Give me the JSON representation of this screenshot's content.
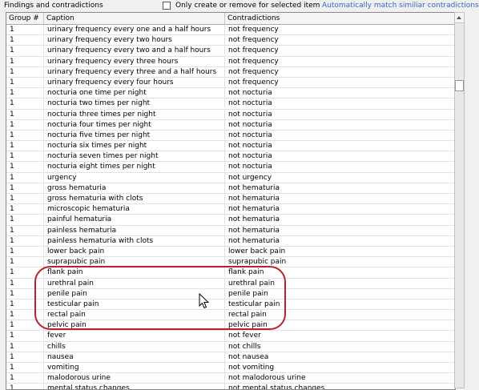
{
  "section_title": "Findings and contradictions",
  "checkbox": {
    "label": "Only create or remove for selected item",
    "checked": false
  },
  "match_link": "Automatically match similiar contradictions",
  "table": {
    "headers": {
      "group": "Group #",
      "caption": "Caption",
      "contradictions": "Contradictions"
    },
    "rows": [
      {
        "group": "1",
        "caption": "urinary frequency every one and a half hours",
        "contra": "not frequency"
      },
      {
        "group": "1",
        "caption": "urinary frequency every two hours",
        "contra": "not frequency"
      },
      {
        "group": "1",
        "caption": "urinary frequency every two and a half hours",
        "contra": "not frequency"
      },
      {
        "group": "1",
        "caption": "urinary frequency every three hours",
        "contra": "not frequency"
      },
      {
        "group": "1",
        "caption": "urinary frequency every three and a half hours",
        "contra": "not frequency"
      },
      {
        "group": "1",
        "caption": "urinary frequency every four hours",
        "contra": "not frequency"
      },
      {
        "group": "1",
        "caption": "nocturia one time per night",
        "contra": "not nocturia"
      },
      {
        "group": "1",
        "caption": "nocturia two times per night",
        "contra": "not nocturia"
      },
      {
        "group": "1",
        "caption": "nocturia three times per night",
        "contra": "not nocturia"
      },
      {
        "group": "1",
        "caption": "nocturia four times per night",
        "contra": "not nocturia"
      },
      {
        "group": "1",
        "caption": "nocturia five times per night",
        "contra": "not nocturia"
      },
      {
        "group": "1",
        "caption": "nocturia six times per night",
        "contra": "not nocturia"
      },
      {
        "group": "1",
        "caption": "nocturia seven times per night",
        "contra": "not nocturia"
      },
      {
        "group": "1",
        "caption": "nocturia eight times per night",
        "contra": "not nocturia"
      },
      {
        "group": "1",
        "caption": "urgency",
        "contra": "not urgency"
      },
      {
        "group": "1",
        "caption": "gross hematuria",
        "contra": "not hematuria"
      },
      {
        "group": "1",
        "caption": "gross hematuria with clots",
        "contra": "not hematuria"
      },
      {
        "group": "1",
        "caption": "microscopic hematuria",
        "contra": "not hematuria"
      },
      {
        "group": "1",
        "caption": "painful hematuria",
        "contra": "not hematuria"
      },
      {
        "group": "1",
        "caption": "painless hematuria",
        "contra": "not hematuria"
      },
      {
        "group": "1",
        "caption": "painless hematuria with clots",
        "contra": "not hematuria"
      },
      {
        "group": "1",
        "caption": "lower back pain",
        "contra": "lower back pain"
      },
      {
        "group": "1",
        "caption": "suprapubic pain",
        "contra": "suprapubic pain"
      },
      {
        "group": "1",
        "caption": "flank pain",
        "contra": "flank pain"
      },
      {
        "group": "1",
        "caption": "urethral pain",
        "contra": "urethral pain"
      },
      {
        "group": "1",
        "caption": "penile pain",
        "contra": "penile pain"
      },
      {
        "group": "1",
        "caption": "testicular pain",
        "contra": "testicular pain"
      },
      {
        "group": "1",
        "caption": "rectal pain",
        "contra": "rectal pain"
      },
      {
        "group": "1",
        "caption": "pelvic pain",
        "contra": "pelvic pain"
      },
      {
        "group": "1",
        "caption": "fever",
        "contra": "not fever"
      },
      {
        "group": "1",
        "caption": "chills",
        "contra": "not chills"
      },
      {
        "group": "1",
        "caption": "nausea",
        "contra": "not nausea"
      },
      {
        "group": "1",
        "caption": "vomiting",
        "contra": "not vomiting"
      },
      {
        "group": "1",
        "caption": "malodorous urine",
        "contra": "not malodorous urine"
      },
      {
        "group": "1",
        "caption": "mental status changes",
        "contra": "not mental status changes"
      }
    ]
  },
  "highlight_color": "#b8232b",
  "link_color": "#3366cc"
}
